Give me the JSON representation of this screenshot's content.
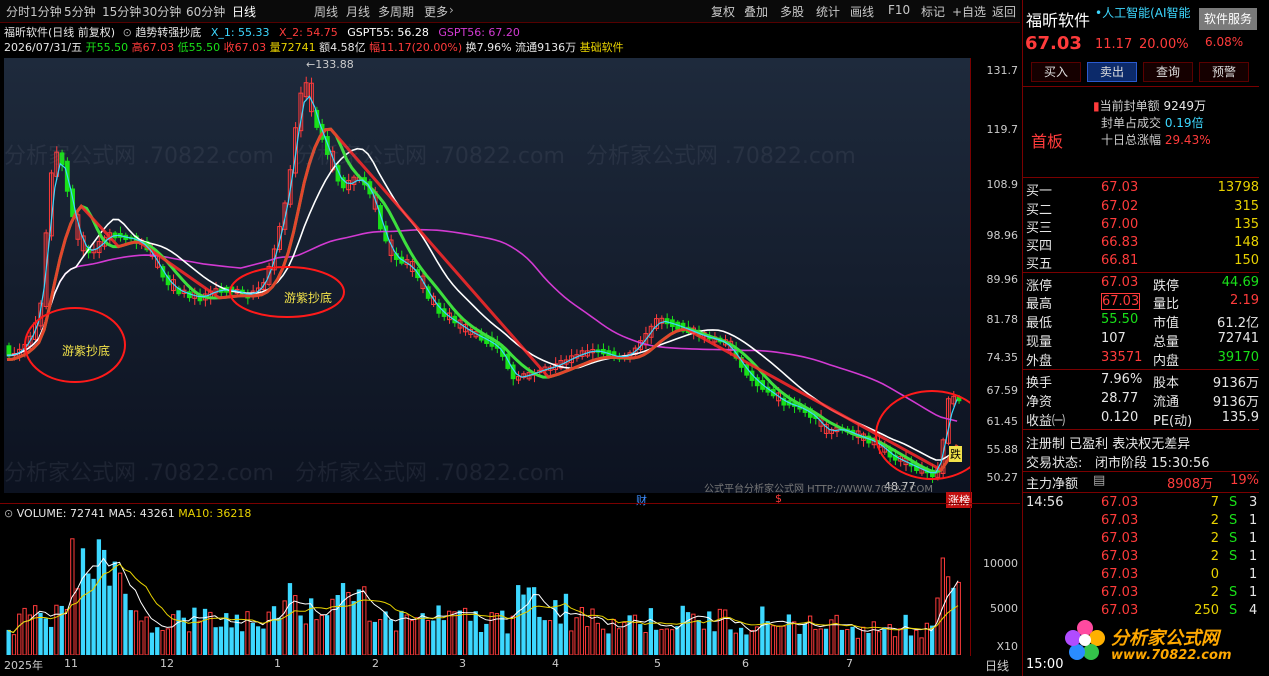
{
  "toolbar": {
    "periods": [
      "分时",
      "1分钟",
      "5分钟",
      "15分钟",
      "30分钟",
      "60分钟",
      "日线",
      "周线",
      "月线",
      "多周期",
      "更多"
    ],
    "active_period": "日线",
    "tools": [
      "复权",
      "叠加",
      "多股",
      "统计",
      "画线",
      "F10",
      "标记",
      "+自选",
      "返回"
    ]
  },
  "info": {
    "title": "福昕软件(日线 前复权)",
    "indicator": "趋势转强抄底",
    "x1": "X_1: 55.33",
    "x2": "X_2: 54.75",
    "gspt55": "GSPT55: 56.28",
    "gspt56": "GSPT56: 67.20",
    "date": "2026/07/31/五",
    "open": "开55.50",
    "high": "高67.03",
    "low": "低55.50",
    "close": "收67.03",
    "vol": "量72741",
    "amount": "额4.58亿",
    "change": "幅11.17(20.00%)",
    "turnover": "换7.96%",
    "float": "流通9136万",
    "sector": "基础软件"
  },
  "price_axis": [
    "131.7",
    "119.7",
    "108.9",
    "98.96",
    "89.96",
    "81.78",
    "74.35",
    "67.59",
    "61.45",
    "55.88",
    "50.27"
  ],
  "annotations": {
    "peak": "133.88",
    "trough": "48.77",
    "signal1": "游紫抄底",
    "signal2": "游紫抄底",
    "signal3": "跌",
    "cai": "财",
    "dollar": "$",
    "zhangting": "涨榜",
    "watermark_small": "公式平台分析家公式网 HTTP://WWW.70822.COM",
    "watermark": "分析家公式网 .70822.com"
  },
  "volume": {
    "label": "VOLUME: 72741",
    "ma5": "MA5: 43261",
    "ma10": "MA10: 36218",
    "axis": [
      "10000",
      "5000"
    ],
    "unit": "X10"
  },
  "date_axis": [
    "2025年",
    "11",
    "12",
    "1",
    "2",
    "3",
    "4",
    "5",
    "6",
    "7"
  ],
  "period_label": "日线",
  "panel": {
    "name": "福昕软件",
    "concept": "人工智能(AI智能",
    "service_btn": "软件服务",
    "price": "67.03",
    "change": "11.17",
    "pct": "20.00%",
    "right_pct": "6.08%",
    "buttons": [
      "买入",
      "卖出",
      "查询",
      "预警"
    ],
    "badge": "首板",
    "seal": [
      {
        "label": "当前封单额",
        "value": "9249万"
      },
      {
        "label": "封单占成交",
        "value": "0.19倍"
      },
      {
        "label": "十日总涨幅",
        "value": "29.43%"
      }
    ],
    "bids": [
      {
        "label": "买一",
        "price": "67.03",
        "vol": "13798"
      },
      {
        "label": "买二",
        "price": "67.02",
        "vol": "315"
      },
      {
        "label": "买三",
        "price": "67.00",
        "vol": "135"
      },
      {
        "label": "买四",
        "price": "66.83",
        "vol": "148"
      },
      {
        "label": "买五",
        "price": "66.81",
        "vol": "150"
      }
    ],
    "stats": [
      {
        "l1": "涨停",
        "v1": "67.03",
        "l2": "跌停",
        "v2": "44.69"
      },
      {
        "l1": "最高",
        "v1": "67.03",
        "l2": "量比",
        "v2": "2.19"
      },
      {
        "l1": "最低",
        "v1": "55.50",
        "l2": "市值",
        "v2": "61.2亿"
      },
      {
        "l1": "现量",
        "v1": "107",
        "l2": "总量",
        "v2": "72741"
      },
      {
        "l1": "外盘",
        "v1": "33571",
        "l2": "内盘",
        "v2": "39170"
      }
    ],
    "stats2": [
      {
        "l1": "换手",
        "v1": "7.96%",
        "l2": "股本",
        "v2": "9136万"
      },
      {
        "l1": "净资",
        "v1": "28.77",
        "l2": "流通",
        "v2": "9136万"
      },
      {
        "l1": "收益㈠",
        "v1": "0.120",
        "l2": "PE(动)",
        "v2": "135.9"
      }
    ],
    "reg": "注册制 已盈利 表决权无差异",
    "trade_status_label": "交易状态:",
    "trade_status": "闭市阶段 15:30:56",
    "main_net_label": "主力净额",
    "main_net": "8908万",
    "main_net_pct": "19%",
    "ticks": [
      {
        "time": "14:56",
        "price": "67.03",
        "vol": "7",
        "dir": "S",
        "n": "3"
      },
      {
        "time": "",
        "price": "67.03",
        "vol": "2",
        "dir": "S",
        "n": "1"
      },
      {
        "time": "",
        "price": "67.03",
        "vol": "2",
        "dir": "S",
        "n": "1"
      },
      {
        "time": "",
        "price": "67.03",
        "vol": "2",
        "dir": "S",
        "n": "1"
      },
      {
        "time": "",
        "price": "67.03",
        "vol": "0",
        "dir": "",
        "n": "1"
      },
      {
        "time": "",
        "price": "67.03",
        "vol": "2",
        "dir": "S",
        "n": "1"
      },
      {
        "time": "",
        "price": "67.03",
        "vol": "250",
        "dir": "S",
        "n": "4"
      }
    ],
    "bottom_time": "15:00",
    "logo_text": "分析家公式网",
    "logo_url": "www.70822.com"
  },
  "colors": {
    "up": "#ff3b3b",
    "down": "#19e019",
    "bg": "#000000",
    "panel": "#1b2433",
    "ma_white": "#ffffff",
    "ma_magenta": "#d23ad2",
    "ma_cyan": "#3dd8ff"
  }
}
